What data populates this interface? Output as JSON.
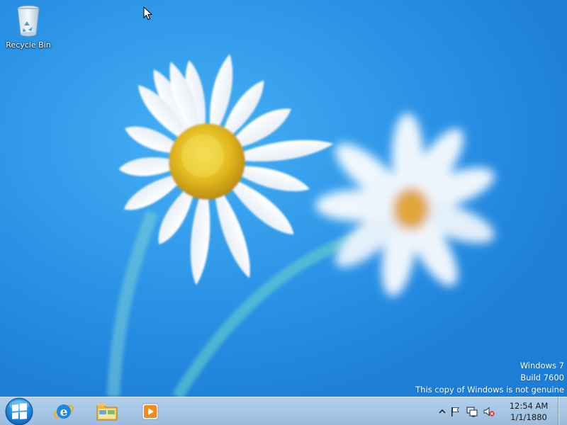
{
  "desktop": {
    "icons": [
      {
        "label": "Recycle Bin",
        "icon": "recycle-bin-icon"
      }
    ]
  },
  "watermark": {
    "line1": "Windows 7",
    "line2": "Build 7600",
    "line3": "This copy of Windows is not genuine"
  },
  "taskbar": {
    "start_icon": "windows-logo-icon",
    "pinned": [
      {
        "name": "Internet Explorer",
        "icon": "internet-explorer-icon"
      },
      {
        "name": "Windows Explorer",
        "icon": "file-explorer-icon"
      },
      {
        "name": "Windows Media Player",
        "icon": "media-player-icon"
      }
    ],
    "tray": {
      "icons": [
        "show-hidden-icons-chevron",
        "action-center-flag-icon",
        "network-icon",
        "volume-muted-icon"
      ],
      "time": "12:54 AM",
      "date": "1/1/1880"
    }
  },
  "colors": {
    "wallpaper": "#2c93e8",
    "taskbar": "#b0cbe6",
    "start_button": "#1e88d8",
    "watermark_text": "#ffffff"
  }
}
